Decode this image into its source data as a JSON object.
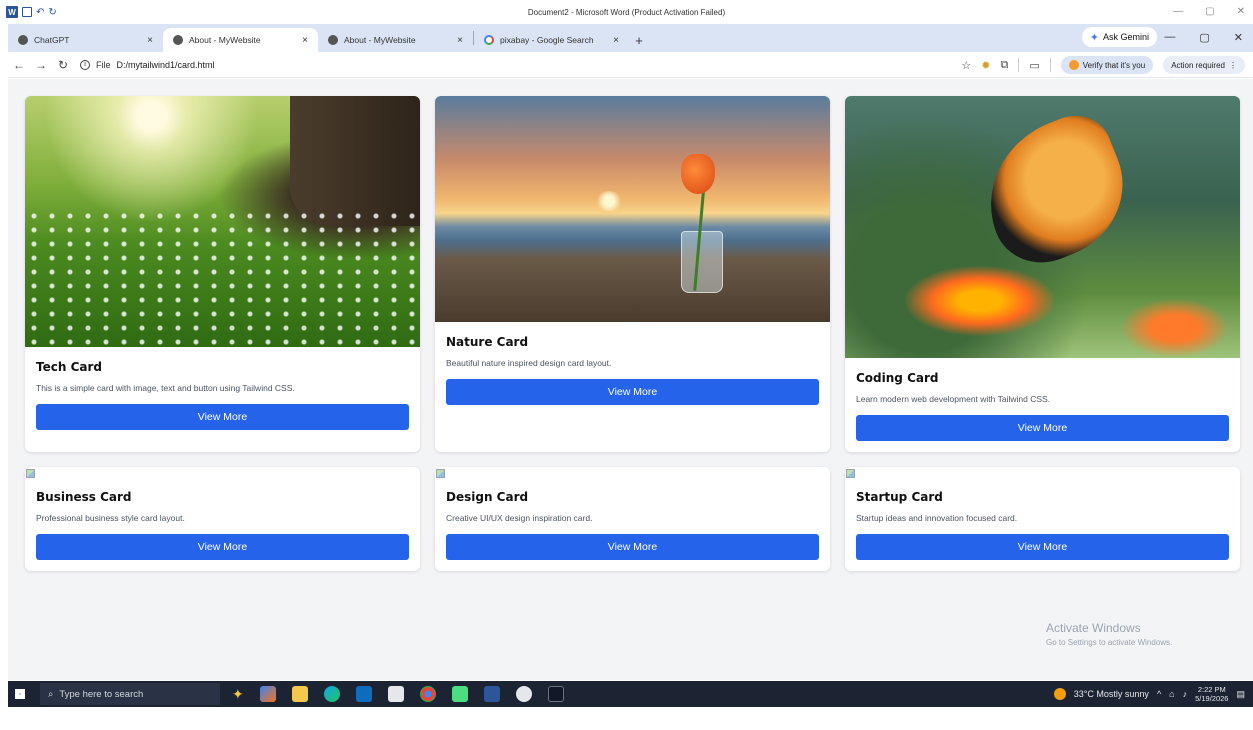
{
  "word": {
    "title": "Document2 - Microsoft Word (Product Activation Failed)",
    "logo": "W"
  },
  "browser": {
    "tabs": [
      {
        "label": "ChatGPT",
        "icon": "chatgpt-icon",
        "active": false
      },
      {
        "label": "About - MyWebsite",
        "icon": "globe-icon",
        "active": true
      },
      {
        "label": "About - MyWebsite",
        "icon": "globe-icon",
        "active": false
      },
      {
        "label": "pixabay - Google Search",
        "icon": "google-icon",
        "active": false
      }
    ],
    "tab_close": "×",
    "new_tab": "+",
    "gemini_label": "Ask Gemini",
    "address": {
      "scheme_label": "File",
      "url": "D:/mytailwind1/card.html"
    },
    "verify_label": "Verify that it's you",
    "action_label": "Action required"
  },
  "cards": [
    {
      "title": "Tech Card",
      "text": "This is a simple card with image, text and button using Tailwind CSS.",
      "button": "View More"
    },
    {
      "title": "Nature Card",
      "text": "Beautiful nature inspired design card layout.",
      "button": "View More"
    },
    {
      "title": "Coding Card",
      "text": "Learn modern web development with Tailwind CSS.",
      "button": "View More"
    },
    {
      "title": "Business Card",
      "text": "Professional business style card layout.",
      "button": "View More"
    },
    {
      "title": "Design Card",
      "text": "Creative UI/UX design inspiration card.",
      "button": "View More"
    },
    {
      "title": "Startup Card",
      "text": "Startup ideas and innovation focused card.",
      "button": "View More"
    }
  ],
  "watermark": {
    "line1": "Activate Windows",
    "line2": "Go to Settings to activate Windows."
  },
  "taskbar": {
    "search_placeholder": "Type here to search",
    "weather": "33°C  Mostly sunny",
    "time": "2:22 PM",
    "date": "5/19/2026"
  },
  "colors": {
    "accent": "#2563eb",
    "page_bg": "#f3f4f6",
    "tabbar": "#dbe4f5",
    "taskbar": "#1c2434"
  }
}
